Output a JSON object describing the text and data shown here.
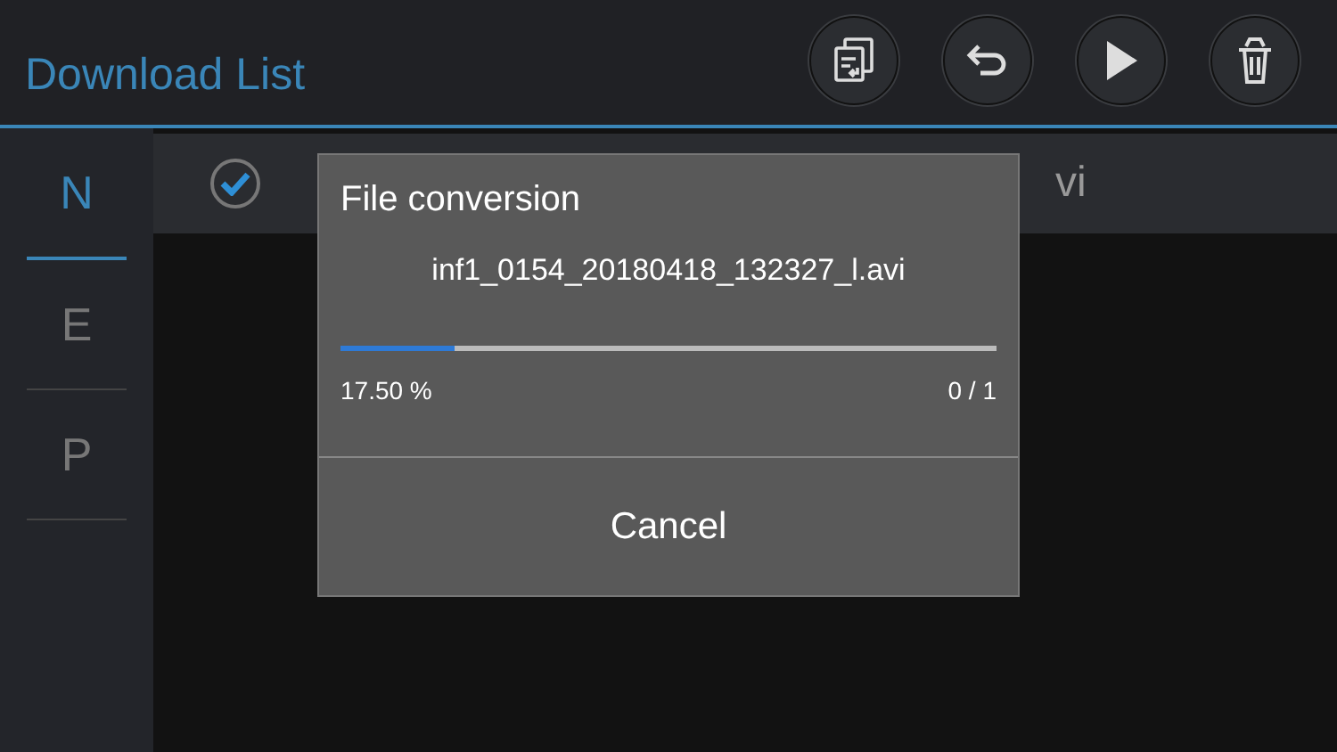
{
  "header": {
    "title": "Download List",
    "toolbar": [
      {
        "kind": "convert"
      },
      {
        "kind": "back"
      },
      {
        "kind": "play"
      },
      {
        "kind": "delete"
      }
    ]
  },
  "tabs": [
    {
      "label": "N",
      "selected": true
    },
    {
      "label": "E",
      "selected": false
    },
    {
      "label": "P",
      "selected": false
    }
  ],
  "rows": [
    {
      "checked": true,
      "name": "vi"
    }
  ],
  "dialog": {
    "title": "File conversion",
    "file": "inf1_0154_20180418_132327_l.avi",
    "level": 0.175,
    "percent": "17.50 %",
    "count": "0 / 1",
    "button": "Cancel"
  }
}
